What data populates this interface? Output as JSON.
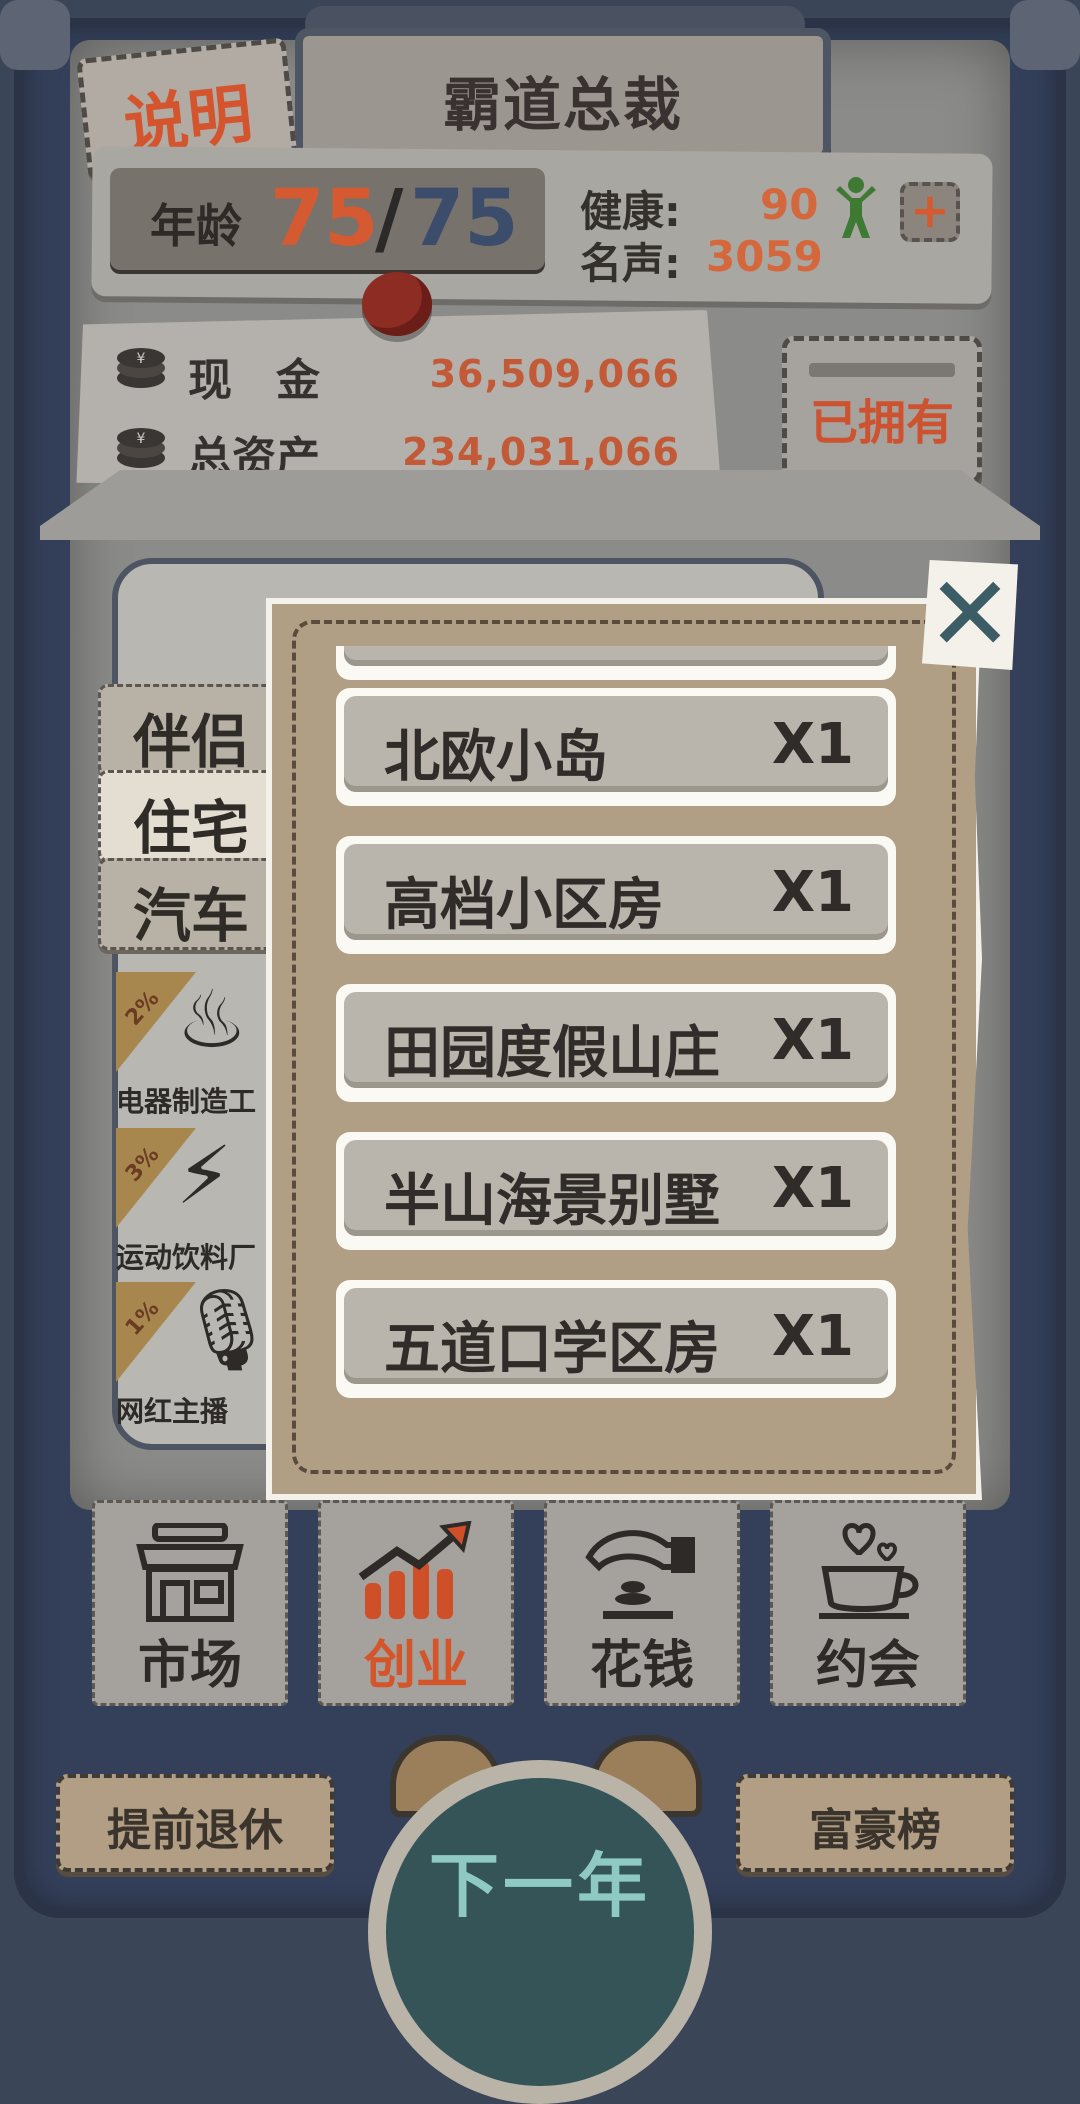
{
  "header": {
    "title": "霸道总裁",
    "explain_label": "说明"
  },
  "stats": {
    "age_label": "年龄",
    "age_current": "75",
    "age_separator": "/",
    "age_max": "75",
    "health_label": "健康:",
    "health_value": "90",
    "fame_label": "名声:",
    "fame_value": "3059",
    "add_icon": "plus-icon"
  },
  "money": {
    "cash_label": "现　金",
    "cash_value": "36,509,066",
    "assets_label": "总资产",
    "assets_value": "234,031,066"
  },
  "owned_button": "已拥有",
  "sidebar": {
    "tabs": [
      {
        "label": "伴侣",
        "active": false
      },
      {
        "label": "住宅",
        "active": true
      },
      {
        "label": "汽车",
        "active": false
      }
    ]
  },
  "background_list": [
    {
      "percent": "2%",
      "name": "电器制造工",
      "icon": "kettle-icon"
    },
    {
      "percent": "3%",
      "name": "运动饮料厂",
      "icon": "bottle-icon"
    },
    {
      "percent": "1%",
      "name": "网红主播",
      "icon": "microphone-icon"
    }
  ],
  "modal": {
    "items": [
      {
        "name": "北欧小岛",
        "qty": "X1"
      },
      {
        "name": "高档小区房",
        "qty": "X1"
      },
      {
        "name": "田园度假山庄",
        "qty": "X1"
      },
      {
        "name": "半山海景别墅",
        "qty": "X1"
      },
      {
        "name": "五道口学区房",
        "qty": "X1"
      }
    ],
    "close_icon": "close-icon"
  },
  "nav": {
    "tabs": [
      {
        "label": "市场",
        "icon": "shop-icon",
        "active": false
      },
      {
        "label": "创业",
        "icon": "growth-chart-icon",
        "active": true
      },
      {
        "label": "花钱",
        "icon": "hand-coins-icon",
        "active": false
      },
      {
        "label": "约会",
        "icon": "coffee-heart-icon",
        "active": false
      }
    ]
  },
  "footer": {
    "retire_label": "提前退休",
    "next_year_label": "下一年",
    "ranking_label": "富豪榜"
  },
  "colors": {
    "accent": "#d4552d",
    "panel": "#b19f85",
    "frame": "#34405a"
  }
}
